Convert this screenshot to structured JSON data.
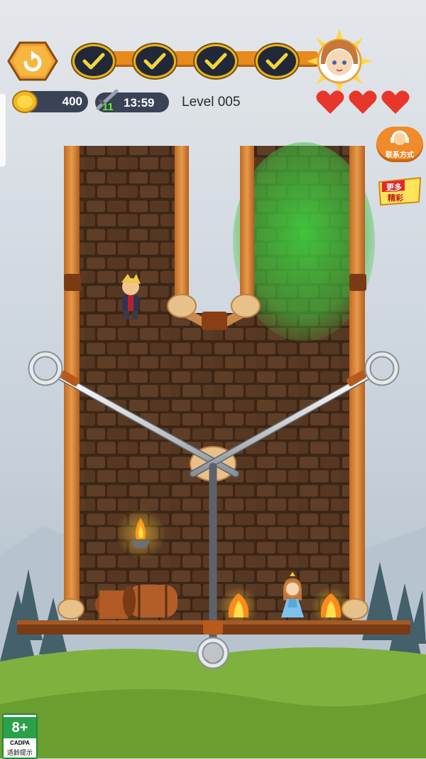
{
  "hud": {
    "coins": "400",
    "energy": "11",
    "timer": "13:59",
    "level": "Level 005",
    "stages_completed": 4,
    "lives": 3
  },
  "side_buttons": {
    "contact_label": "联系方式",
    "more_line1": "更多",
    "more_line2": "精彩"
  },
  "age_rating": {
    "age": "8+",
    "org": "CADPA",
    "tip": "适龄提示"
  },
  "colors": {
    "accent_orange": "#e88a1c",
    "brick": "#5a3a22",
    "wood": "#d98a3c",
    "heart": "#e8362a",
    "grass": "#7fb13e",
    "poison_gas": "#3fbf3f"
  },
  "icons": [
    "restart-icon",
    "checkmark-icon",
    "coin-icon",
    "sword-icon",
    "heart-icon",
    "headset-icon"
  ]
}
